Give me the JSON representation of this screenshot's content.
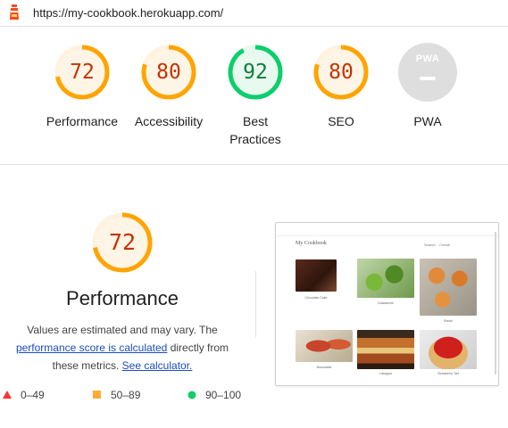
{
  "url_bar": {
    "url": "https://my-cookbook.herokuapp.com/",
    "icon": "lighthouse-icon"
  },
  "gauges": [
    {
      "score": "72",
      "label": "Performance",
      "status": "average"
    },
    {
      "score": "80",
      "label": "Accessibility",
      "status": "average"
    },
    {
      "score": "92",
      "label": "Best Practices",
      "status": "pass"
    },
    {
      "score": "80",
      "label": "SEO",
      "status": "average"
    },
    {
      "score": "",
      "label": "PWA",
      "status": "na",
      "badge_text": "PWA"
    }
  ],
  "performance": {
    "score": "72",
    "title": "Performance",
    "desc_part1": "Values are estimated and may vary. The",
    "desc_link": "performance score is calculated",
    "desc_part2": "directly from these metrics.",
    "calc_link": "See calculator."
  },
  "legend": [
    {
      "range": "0–49",
      "shape": "triangle",
      "color": "#ff3333"
    },
    {
      "range": "50–89",
      "shape": "square",
      "color": "#ffaa33"
    },
    {
      "range": "90–100",
      "shape": "circle",
      "color": "#0cce6b"
    }
  ],
  "screenshot": {
    "brand": "My Cookbook",
    "nav": [
      "Search",
      "Create"
    ],
    "recipes": [
      "Chocolate Cake",
      "Guacamole",
      "Bread",
      "Bruschetta",
      "Lasagna",
      "Strawberry Tart"
    ]
  },
  "colors": {
    "orange": "#ffa400",
    "green": "#0cce6b",
    "score_red": "#c33300"
  }
}
